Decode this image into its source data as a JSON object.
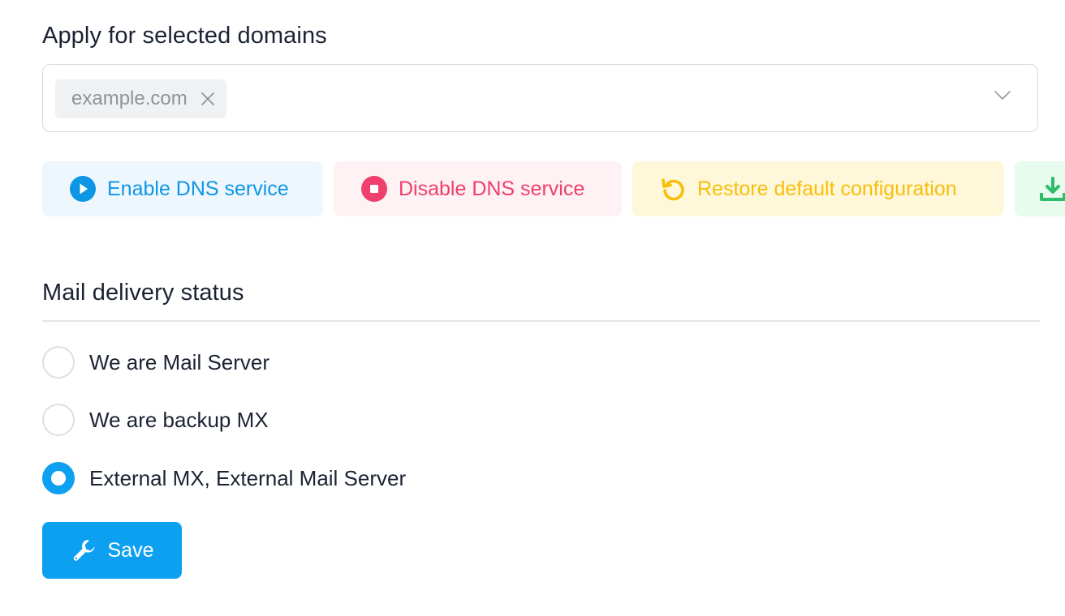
{
  "domains": {
    "heading": "Apply for selected domains",
    "selected_tags": [
      "example.com"
    ]
  },
  "actions": {
    "enable_label": "Enable DNS service",
    "disable_label": "Disable DNS service",
    "restore_label": "Restore default configuration"
  },
  "mail": {
    "heading": "Mail delivery status",
    "options": [
      {
        "label": "We are Mail Server",
        "checked": false
      },
      {
        "label": "We are backup MX",
        "checked": false
      },
      {
        "label": "External MX, External Mail Server",
        "checked": true
      }
    ]
  },
  "save": {
    "label": "Save"
  },
  "icons": {
    "tag_remove": "close-icon",
    "select_dropdown": "chevron-down-icon",
    "enable": "play-circle-icon",
    "disable": "stop-circle-icon",
    "restore": "undo-icon",
    "download": "download-icon",
    "save": "wrench-icon"
  },
  "colors": {
    "primary": "#0ea0f0",
    "enable_bg": "#eef7fe",
    "enable_fg": "#0e96e6",
    "disable_bg": "#fef2f5",
    "disable_fg": "#ef3f6c",
    "restore_bg": "#fff7d9",
    "restore_fg": "#f7be0b",
    "download_bg": "#e7fbef",
    "download_fg": "#2fbd6a"
  }
}
